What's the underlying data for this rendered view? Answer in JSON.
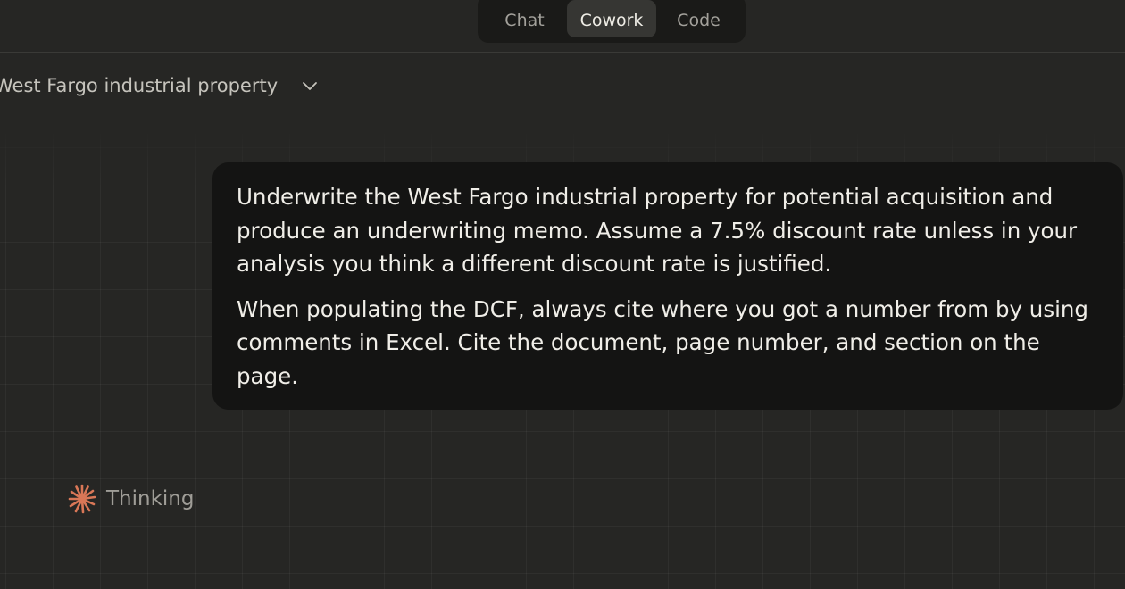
{
  "modes": {
    "chat_label": "Chat",
    "cowork_label": "Cowork",
    "code_label": "Code",
    "active": "Cowork"
  },
  "conversation": {
    "title": "West Fargo industrial property"
  },
  "message": {
    "paragraph_1": "Underwrite the West Fargo industrial property for potential acquisition and produce an underwriting memo. Assume a 7.5% discount rate unless in your analysis you think a different discount rate is justified.",
    "paragraph_2": "When populating the DCF, always cite where you got a number from by using comments in Excel. Cite the document, page number, and section on the page."
  },
  "status": {
    "thinking_label": "Thinking",
    "icon": "spark-icon"
  },
  "colors": {
    "background": "#262624",
    "bubble": "#141413",
    "accent": "#d97757",
    "active_tab": "#363633"
  }
}
